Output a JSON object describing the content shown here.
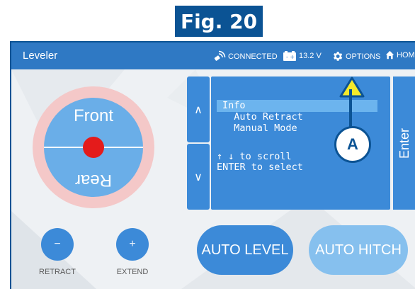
{
  "figure": {
    "label": "Fig. 20"
  },
  "header": {
    "title": "Leveler",
    "connection": "CONNECTED",
    "voltage": "13.2 V",
    "options": "OPTIONS",
    "home": "HOME"
  },
  "leveler": {
    "front": "Front",
    "rear": "Rear"
  },
  "menu": {
    "lines": [
      "Info",
      "  Auto Retract",
      "  Manual Mode",
      "",
      "↑ ↓ to scroll",
      "ENTER to select"
    ],
    "enter": "Enter",
    "up": "∧",
    "down": "∨"
  },
  "controls": {
    "retract_symbol": "−",
    "extend_symbol": "+",
    "retract": "RETRACT",
    "extend": "EXTEND",
    "auto_level": "AUTO LEVEL",
    "auto_hitch": "AUTO HITCH"
  },
  "callout": {
    "label": "A"
  },
  "colors": {
    "header": "#2f79c4",
    "button": "#3c8ad8",
    "button_disabled": "#86c0ee",
    "indicator": "#e41b1b",
    "callout": "#0b5394"
  }
}
